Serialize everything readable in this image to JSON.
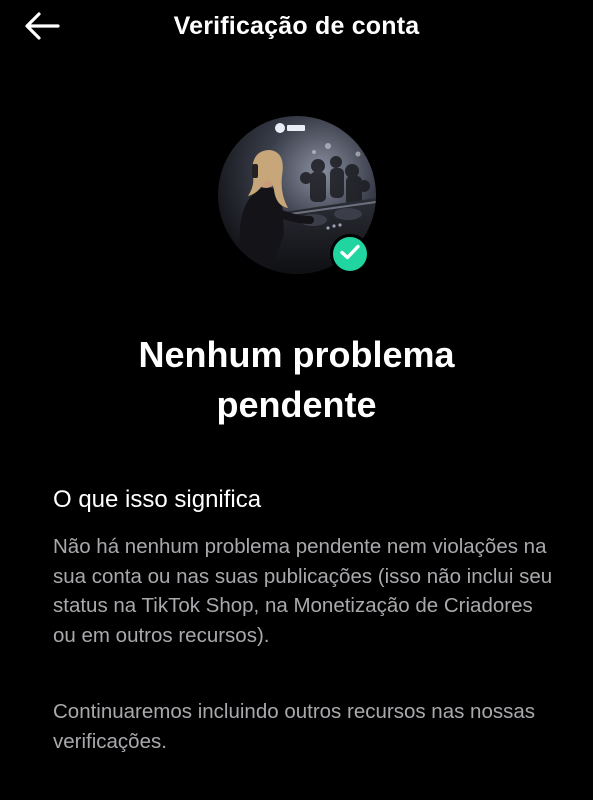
{
  "header": {
    "title": "Verificação de conta",
    "back_icon": "arrow-left-icon"
  },
  "profile": {
    "avatar_icon": "avatar",
    "badge_icon": "check-icon",
    "badge_color": "#20d5a0"
  },
  "status": {
    "title_line1": "Nenhum problema",
    "title_line2": "pendente"
  },
  "info": {
    "heading": "O que isso significa",
    "paragraph1": "Não há nenhum problema pendente nem violações na sua conta ou nas suas publicações (isso não inclui seu status na TikTok Shop, na Monetização de Criadores ou em outros recursos).",
    "paragraph2": "Continuaremos incluindo outros recursos nas nossas verificações."
  },
  "colors": {
    "background": "#000000",
    "text_primary": "#ffffff",
    "text_secondary": "#a9a9ad",
    "accent": "#20d5a0"
  }
}
